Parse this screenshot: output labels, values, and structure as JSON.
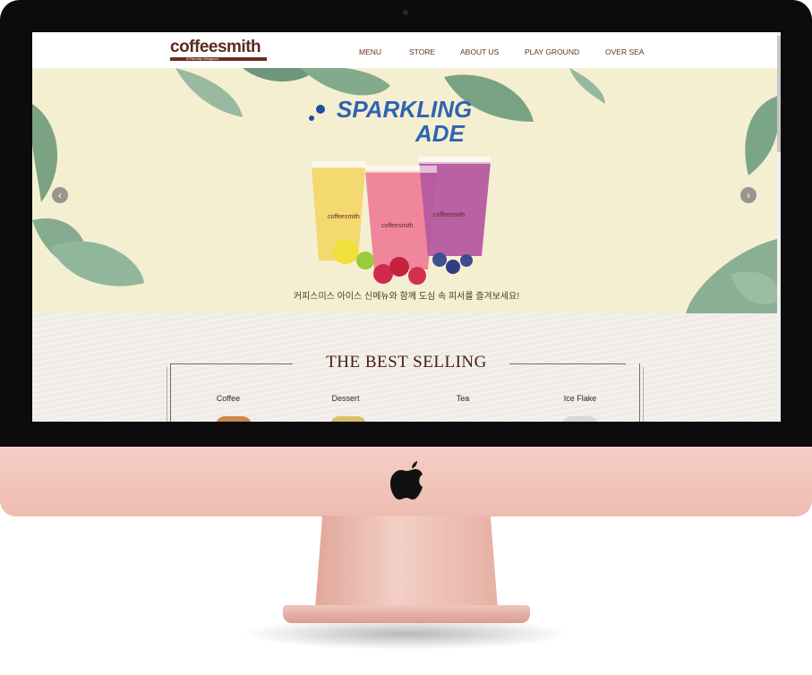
{
  "header": {
    "logo_text": "coffeesmith",
    "logo_tagline": "A Friendly Designed",
    "nav": [
      {
        "label": "MENU"
      },
      {
        "label": "STORE"
      },
      {
        "label": "ABOUT US"
      },
      {
        "label": "PLAY GROUND"
      },
      {
        "label": "OVER SEA"
      }
    ]
  },
  "hero": {
    "title_line1": "SPARKLING",
    "title_line2": "ADE",
    "cup_brand": "coffeesmith",
    "caption": "커피스미스 아이스 신메뉴와 함께 도심 속 피서를 즐겨보세요!",
    "prev_label": "‹",
    "next_label": "›"
  },
  "best_selling": {
    "title": "THE BEST SELLING",
    "categories": [
      {
        "label": "Coffee"
      },
      {
        "label": "Dessert"
      },
      {
        "label": "Tea"
      },
      {
        "label": "Ice Flake"
      }
    ]
  },
  "colors": {
    "brand_brown": "#6b2e1f",
    "hero_bg": "#f5efd2",
    "section_bg": "#efece6",
    "monitor_pink": "#f1c5bb"
  },
  "icons": [
    "apple-logo-icon",
    "chevron-left-icon",
    "chevron-right-icon"
  ]
}
